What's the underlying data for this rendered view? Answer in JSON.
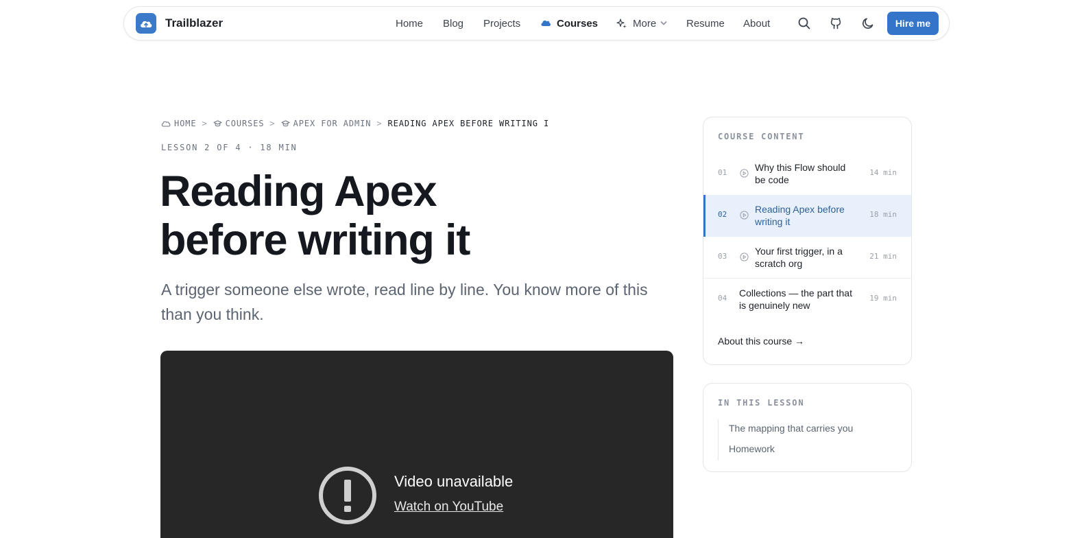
{
  "nav": {
    "brand": "Trailblazer",
    "links": [
      "Home",
      "Blog",
      "Projects",
      "Courses",
      "More",
      "Resume",
      "About"
    ],
    "active": "Courses",
    "hire_label": "Hire me",
    "accent": "#3575c9"
  },
  "breadcrumb": {
    "items": [
      "HOME",
      "COURSES",
      "APEX FOR ADMIN",
      "READING APEX BEFORE WRITING I"
    ]
  },
  "lesson_meta": "LESSON 2 OF 4 · 18 MIN",
  "title_line1": "Reading Apex",
  "title_line2": "before writing it",
  "subtitle": "A trigger someone else wrote, read line by line. You know more of this than you think.",
  "video": {
    "title": "Video unavailable",
    "link": "Watch on YouTube"
  },
  "course_content": {
    "heading": "COURSE CONTENT",
    "lessons": [
      {
        "num": "01",
        "title": "Why this Flow should be code",
        "duration": "14 min"
      },
      {
        "num": "02",
        "title": "Reading Apex before writing it",
        "duration": "18 min"
      },
      {
        "num": "03",
        "title": "Your first trigger, in a scratch org",
        "duration": "21 min"
      },
      {
        "num": "04",
        "title": "Collections — the part that is genuinely new",
        "duration": "19 min"
      }
    ],
    "about_link": "About this course →"
  },
  "in_this_lesson": {
    "heading": "IN THIS LESSON",
    "items": [
      "The mapping that carries you",
      "Homework"
    ]
  }
}
